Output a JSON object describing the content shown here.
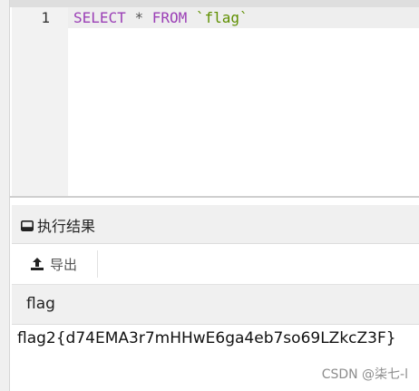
{
  "editor": {
    "line_number": "1",
    "code": {
      "select_kw": "SELECT",
      "star": "*",
      "from_kw": "FROM",
      "table": "`flag`"
    }
  },
  "results": {
    "panel_title": "执行结果",
    "export_label": "导出",
    "column_header": "flag",
    "cell_value": "flag2{d74EMA3r7mHHwE6ga4eb7so69LZkcZ3F}"
  },
  "watermark": "CSDN @柒七-l",
  "icons": [
    "result-panel-icon",
    "export-upload-icon"
  ],
  "colors": {
    "keyword": "#9b3fb6",
    "string": "#5f8f00",
    "panel_bg": "#f0f0f0"
  }
}
